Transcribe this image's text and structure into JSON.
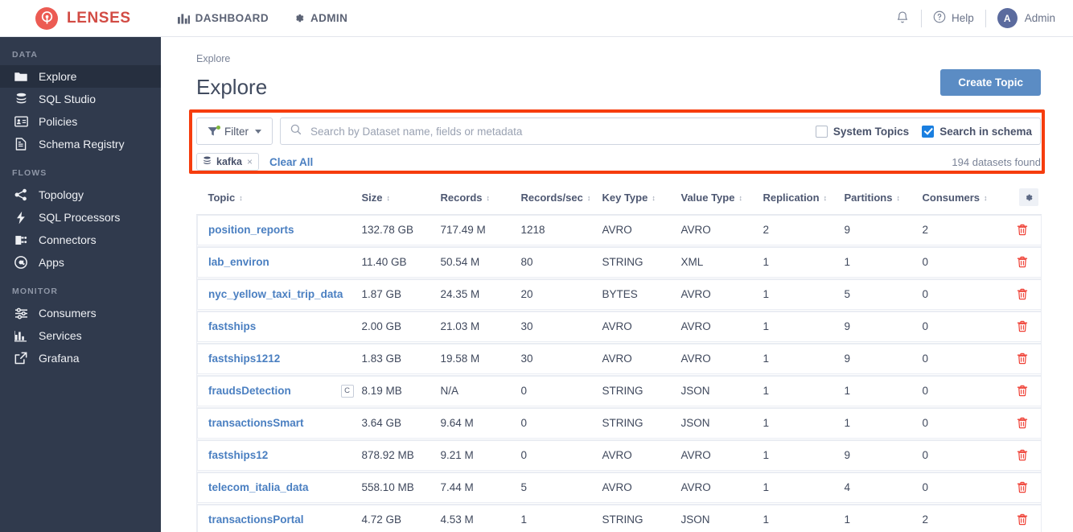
{
  "header": {
    "brand": "LENSES",
    "brand_icon": "lenses-logo-icon",
    "nav": [
      {
        "label": "DASHBOARD",
        "icon": "bar-chart-icon"
      },
      {
        "label": "ADMIN",
        "icon": "gear-icon"
      }
    ],
    "notifications_icon": "bell-icon",
    "help_label": "Help",
    "help_icon": "question-circle-icon",
    "user_initial": "A",
    "user_name": "Admin"
  },
  "sidebar": {
    "groups": [
      {
        "title": "DATA",
        "items": [
          {
            "label": "Explore",
            "icon": "folder-icon",
            "active": true
          },
          {
            "label": "SQL Studio",
            "icon": "database-icon",
            "active": false
          },
          {
            "label": "Policies",
            "icon": "id-card-icon",
            "active": false
          },
          {
            "label": "Schema Registry",
            "icon": "document-icon",
            "active": false
          }
        ]
      },
      {
        "title": "FLOWS",
        "items": [
          {
            "label": "Topology",
            "icon": "share-nodes-icon",
            "active": false
          },
          {
            "label": "SQL Processors",
            "icon": "bolt-icon",
            "active": false
          },
          {
            "label": "Connectors",
            "icon": "plug-icon",
            "active": false
          },
          {
            "label": "Apps",
            "icon": "at-circle-icon",
            "active": false
          }
        ]
      },
      {
        "title": "MONITOR",
        "items": [
          {
            "label": "Consumers",
            "icon": "sliders-icon",
            "active": false
          },
          {
            "label": "Services",
            "icon": "bar-chart-icon",
            "active": false
          },
          {
            "label": "Grafana",
            "icon": "external-link-icon",
            "active": false
          }
        ]
      }
    ]
  },
  "main": {
    "breadcrumb": "Explore",
    "page_title": "Explore",
    "create_topic_label": "Create Topic"
  },
  "filters": {
    "filter_button_label": "Filter",
    "filter_icon": "funnel-icon",
    "filter_has_active_dot": true,
    "search_placeholder": "Search by Dataset name, fields or metadata",
    "search_value": "",
    "search_icon": "search-icon",
    "checkboxes": [
      {
        "label": "System Topics",
        "checked": false
      },
      {
        "label": "Search in schema",
        "checked": true
      }
    ],
    "chips": [
      {
        "label": "kafka",
        "icon": "database-icon",
        "remove": "×"
      }
    ],
    "clear_all_label": "Clear All",
    "results_count": "194 datasets found",
    "highlight_color": "#f63d0e"
  },
  "table": {
    "columns": [
      "Topic",
      "Size",
      "Records",
      "Records/sec",
      "Key Type",
      "Value Type",
      "Replication",
      "Partitions",
      "Consumers"
    ],
    "settings_icon": "gear-icon",
    "delete_icon": "trash-icon",
    "rows": [
      {
        "topic": "position_reports",
        "badge": "",
        "size": "132.78 GB",
        "records": "717.49 M",
        "records_sec": "1218",
        "key_type": "AVRO",
        "value_type": "AVRO",
        "replication": "2",
        "partitions": "9",
        "consumers": "2"
      },
      {
        "topic": "lab_environ",
        "badge": "",
        "size": "11.40 GB",
        "records": "50.54 M",
        "records_sec": "80",
        "key_type": "STRING",
        "value_type": "XML",
        "replication": "1",
        "partitions": "1",
        "consumers": "0"
      },
      {
        "topic": "nyc_yellow_taxi_trip_data",
        "badge": "",
        "size": "1.87 GB",
        "records": "24.35 M",
        "records_sec": "20",
        "key_type": "BYTES",
        "value_type": "AVRO",
        "replication": "1",
        "partitions": "5",
        "consumers": "0"
      },
      {
        "topic": "fastships",
        "badge": "",
        "size": "2.00 GB",
        "records": "21.03 M",
        "records_sec": "30",
        "key_type": "AVRO",
        "value_type": "AVRO",
        "replication": "1",
        "partitions": "9",
        "consumers": "0"
      },
      {
        "topic": "fastships1212",
        "badge": "",
        "size": "1.83 GB",
        "records": "19.58 M",
        "records_sec": "30",
        "key_type": "AVRO",
        "value_type": "AVRO",
        "replication": "1",
        "partitions": "9",
        "consumers": "0"
      },
      {
        "topic": "fraudsDetection",
        "badge": "C",
        "size": "8.19 MB",
        "records": "N/A",
        "records_sec": "0",
        "key_type": "STRING",
        "value_type": "JSON",
        "replication": "1",
        "partitions": "1",
        "consumers": "0"
      },
      {
        "topic": "transactionsSmart",
        "badge": "",
        "size": "3.64 GB",
        "records": "9.64 M",
        "records_sec": "0",
        "key_type": "STRING",
        "value_type": "JSON",
        "replication": "1",
        "partitions": "1",
        "consumers": "0"
      },
      {
        "topic": "fastships12",
        "badge": "",
        "size": "878.92 MB",
        "records": "9.21 M",
        "records_sec": "0",
        "key_type": "AVRO",
        "value_type": "AVRO",
        "replication": "1",
        "partitions": "9",
        "consumers": "0"
      },
      {
        "topic": "telecom_italia_data",
        "badge": "",
        "size": "558.10 MB",
        "records": "7.44 M",
        "records_sec": "5",
        "key_type": "AVRO",
        "value_type": "AVRO",
        "replication": "1",
        "partitions": "4",
        "consumers": "0"
      },
      {
        "topic": "transactionsPortal",
        "badge": "",
        "size": "4.72 GB",
        "records": "4.53 M",
        "records_sec": "1",
        "key_type": "STRING",
        "value_type": "JSON",
        "replication": "1",
        "partitions": "1",
        "consumers": "2"
      }
    ]
  },
  "colors": {
    "brand_red": "#d24b44",
    "sidebar_bg": "#303a4d",
    "link_blue": "#4a7fc1",
    "accent_blue": "#5b8cc4",
    "delete_red": "#ef4136",
    "highlight_orange": "#f63d0e"
  }
}
